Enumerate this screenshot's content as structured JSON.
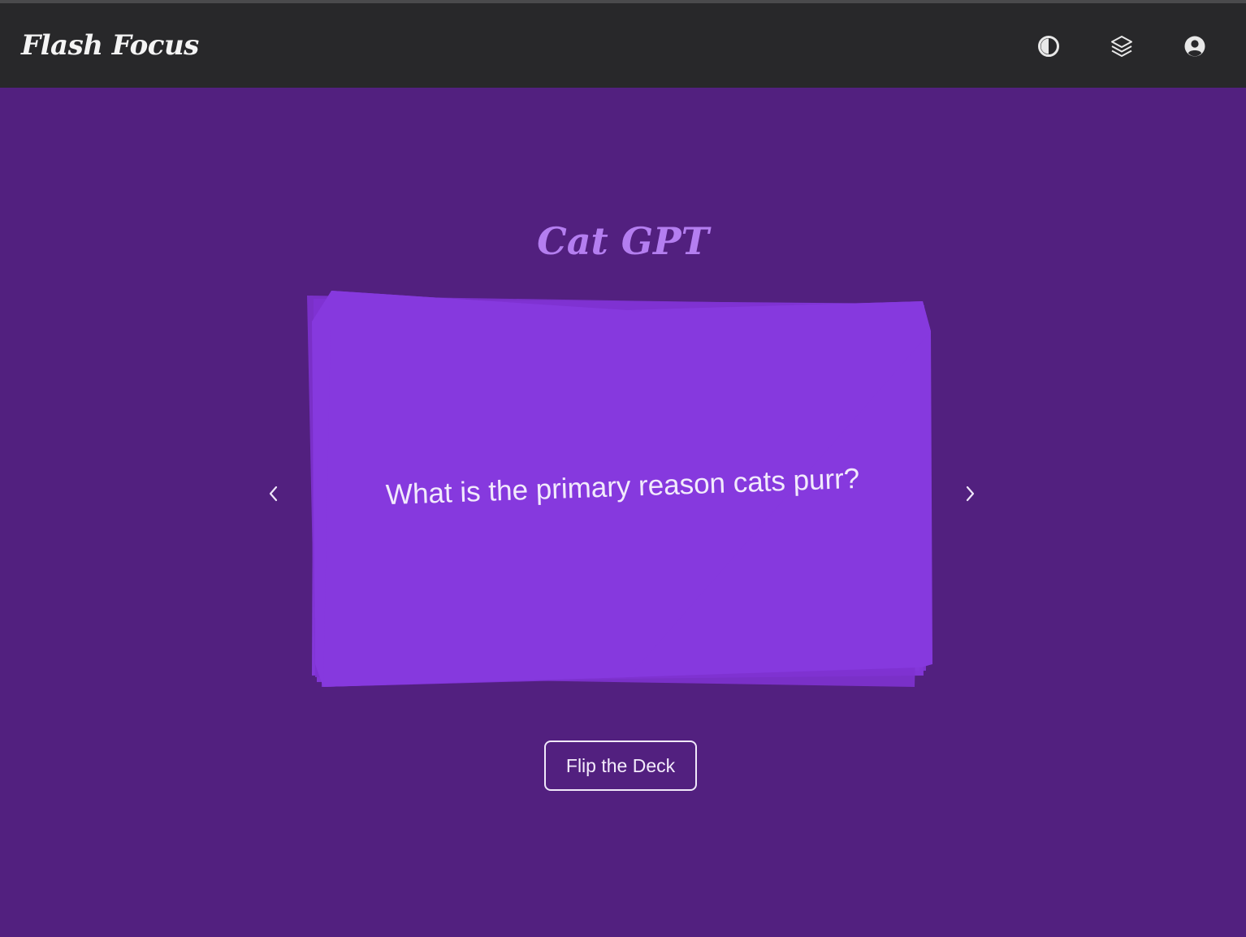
{
  "app": {
    "brand": "Flash Focus"
  },
  "navbar": {
    "icons": [
      "contrast-toggle-icon",
      "layers-icon",
      "user-account-icon"
    ]
  },
  "deck": {
    "title": "Cat GPT",
    "current_card": {
      "side": "front",
      "text": "What is the primary reason cats purr?"
    }
  },
  "actions": {
    "flip_label": "Flip the Deck"
  },
  "colors": {
    "background": "#52207f",
    "navbar": "#28282a",
    "card": "#8639de",
    "title": "#b47ef0",
    "text": "#f2eafc"
  }
}
